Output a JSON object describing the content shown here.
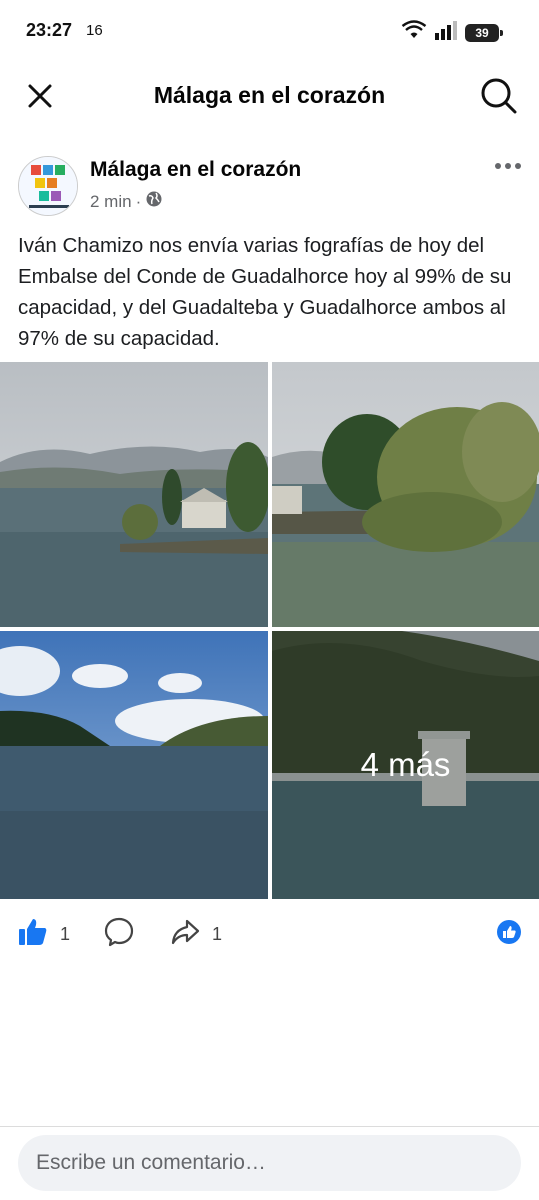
{
  "status_bar": {
    "time": "23:27",
    "extra": "16",
    "battery": "39"
  },
  "top_bar": {
    "title": "Málaga en el corazón"
  },
  "post": {
    "page_name": "Málaga en el corazón",
    "time_ago": "2 min",
    "separator": "·",
    "text": "Iván Chamizo nos envía varias fografías de hoy del Embalse del Conde de Guadalhorce hoy al 99% de su capacidad, y del Guadalteba y Guadalhorce ambos al 97% de su capacidad.",
    "more_photos": "4 más"
  },
  "actions": {
    "like_count": "1",
    "share_count": "1"
  },
  "comment": {
    "placeholder": "Escribe un comentario…"
  },
  "colors": {
    "accent": "#1877f2",
    "secondary_text": "#65676b"
  }
}
